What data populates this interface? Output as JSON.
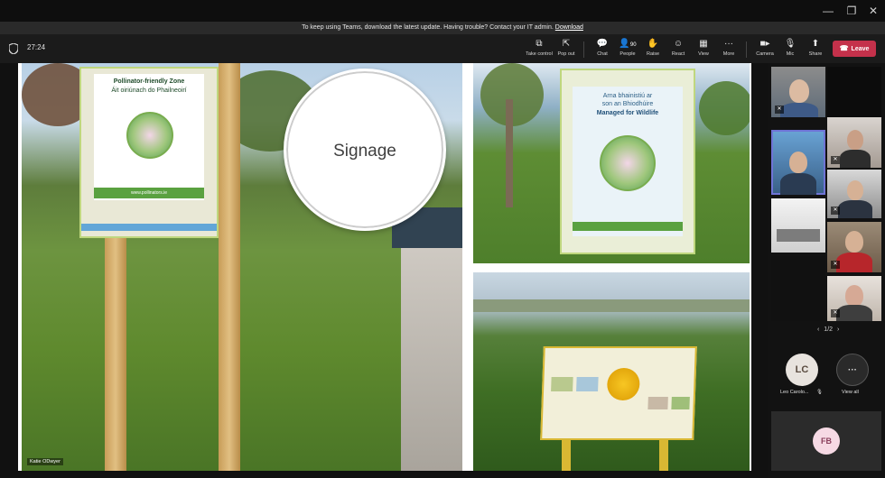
{
  "banner": {
    "text": "To keep using Teams, download the latest update. Having trouble? Contact your IT admin.",
    "link": "Download"
  },
  "toolbar": {
    "timer": "27:24",
    "buttons": [
      {
        "label": "Take control",
        "icon": "take-control-icon"
      },
      {
        "label": "Pop out",
        "icon": "pop-out-icon"
      },
      {
        "label": "Chat",
        "icon": "chat-icon"
      },
      {
        "label": "People",
        "icon": "people-icon",
        "count": "90"
      },
      {
        "label": "Raise",
        "icon": "raise-hand-icon"
      },
      {
        "label": "React",
        "icon": "react-icon"
      },
      {
        "label": "View",
        "icon": "view-icon"
      },
      {
        "label": "More",
        "icon": "more-icon"
      },
      {
        "label": "Camera",
        "icon": "camera-icon"
      },
      {
        "label": "Mic",
        "icon": "mic-icon"
      },
      {
        "label": "Share",
        "icon": "share-icon"
      }
    ],
    "leave_label": "Leave"
  },
  "slide": {
    "callout": "Signage",
    "presenter": "Katie ODwyer",
    "signs": {
      "left": {
        "line1": "Pollinator-friendly Zone",
        "line2": "Áit oiriúnach do Phailneoirí",
        "url": "www.pollinators.ie"
      },
      "topright": {
        "line1": "Arna bhainistiú ar",
        "line2": "son an Bhiodhúire",
        "line3": "Managed for Wildlife"
      }
    }
  },
  "participants": {
    "pager": "1/2",
    "people": [
      {
        "initials": "LC",
        "name": "Leo Carolo...",
        "avatar_bg": "#e8e3de",
        "avatar_fg": "#5a4b40"
      }
    ],
    "view_all_label": "View all",
    "bottom": {
      "initials": "FB",
      "avatar_bg": "#f6d9e4",
      "avatar_fg": "#8a3f5c"
    }
  },
  "colors": {
    "leave": "#c4314b",
    "selected_tile": "#6f74d6"
  }
}
